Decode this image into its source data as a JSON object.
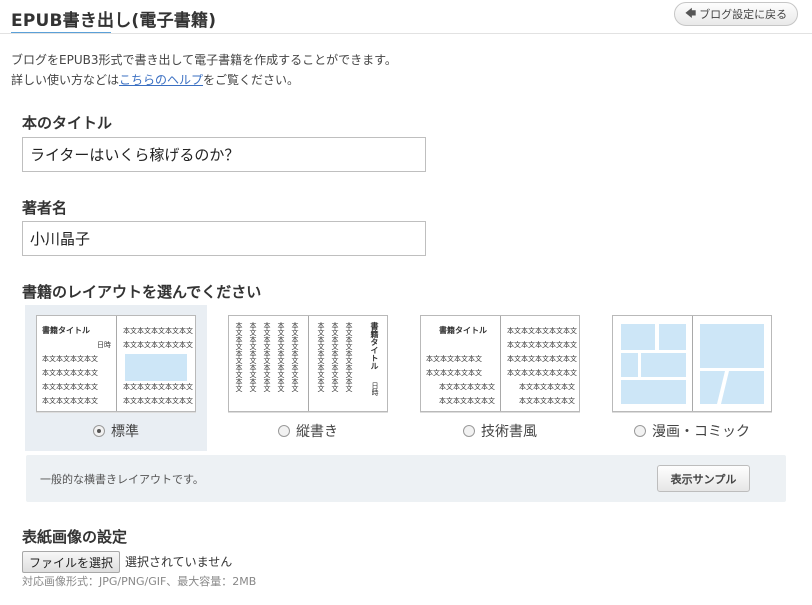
{
  "header": {
    "title": "EPUB書き出し(電子書籍)",
    "back_button": "ブログ設定に戻る"
  },
  "intro": {
    "line1": "ブログをEPUB3形式で書き出して電子書籍を作成することができます。",
    "line2_prefix": "詳しい使い方などは",
    "help_link": "こちらのヘルプ",
    "line2_suffix": "をご覧ください。"
  },
  "book_title": {
    "label": "本のタイトル",
    "value": "ライターはいくら稼げるのか？"
  },
  "author": {
    "label": "著者名",
    "value": "小川晶子"
  },
  "layout_section": {
    "label": "書籍のレイアウトを選んでください",
    "options": [
      {
        "label": "標準",
        "selected": true
      },
      {
        "label": "縦書き",
        "selected": false
      },
      {
        "label": "技術書風",
        "selected": false
      },
      {
        "label": "漫画・コミック",
        "selected": false
      }
    ],
    "thumb": {
      "book_title_h": "書籍タイトル",
      "date": "日時",
      "text_line": "本文本文本文本文",
      "text_line_long": "本文本文本文本文本文",
      "book_title_v": "書籍タイトル",
      "text_col": "本文本文本文本文本文"
    },
    "description": "一般的な横書きレイアウトです。",
    "sample_button": "表示サンプル"
  },
  "cover": {
    "label": "表紙画像の設定",
    "file_button": "ファイルを選択",
    "file_status": "選択されていません",
    "note": "対応画像形式：JPG/PNG/GIF、最大容量：2MB"
  },
  "colors": {
    "accent": "#5aa0d8",
    "link": "#3a6fc2",
    "selected_bg": "#e9eef3",
    "image_placeholder": "#cde6f7"
  }
}
